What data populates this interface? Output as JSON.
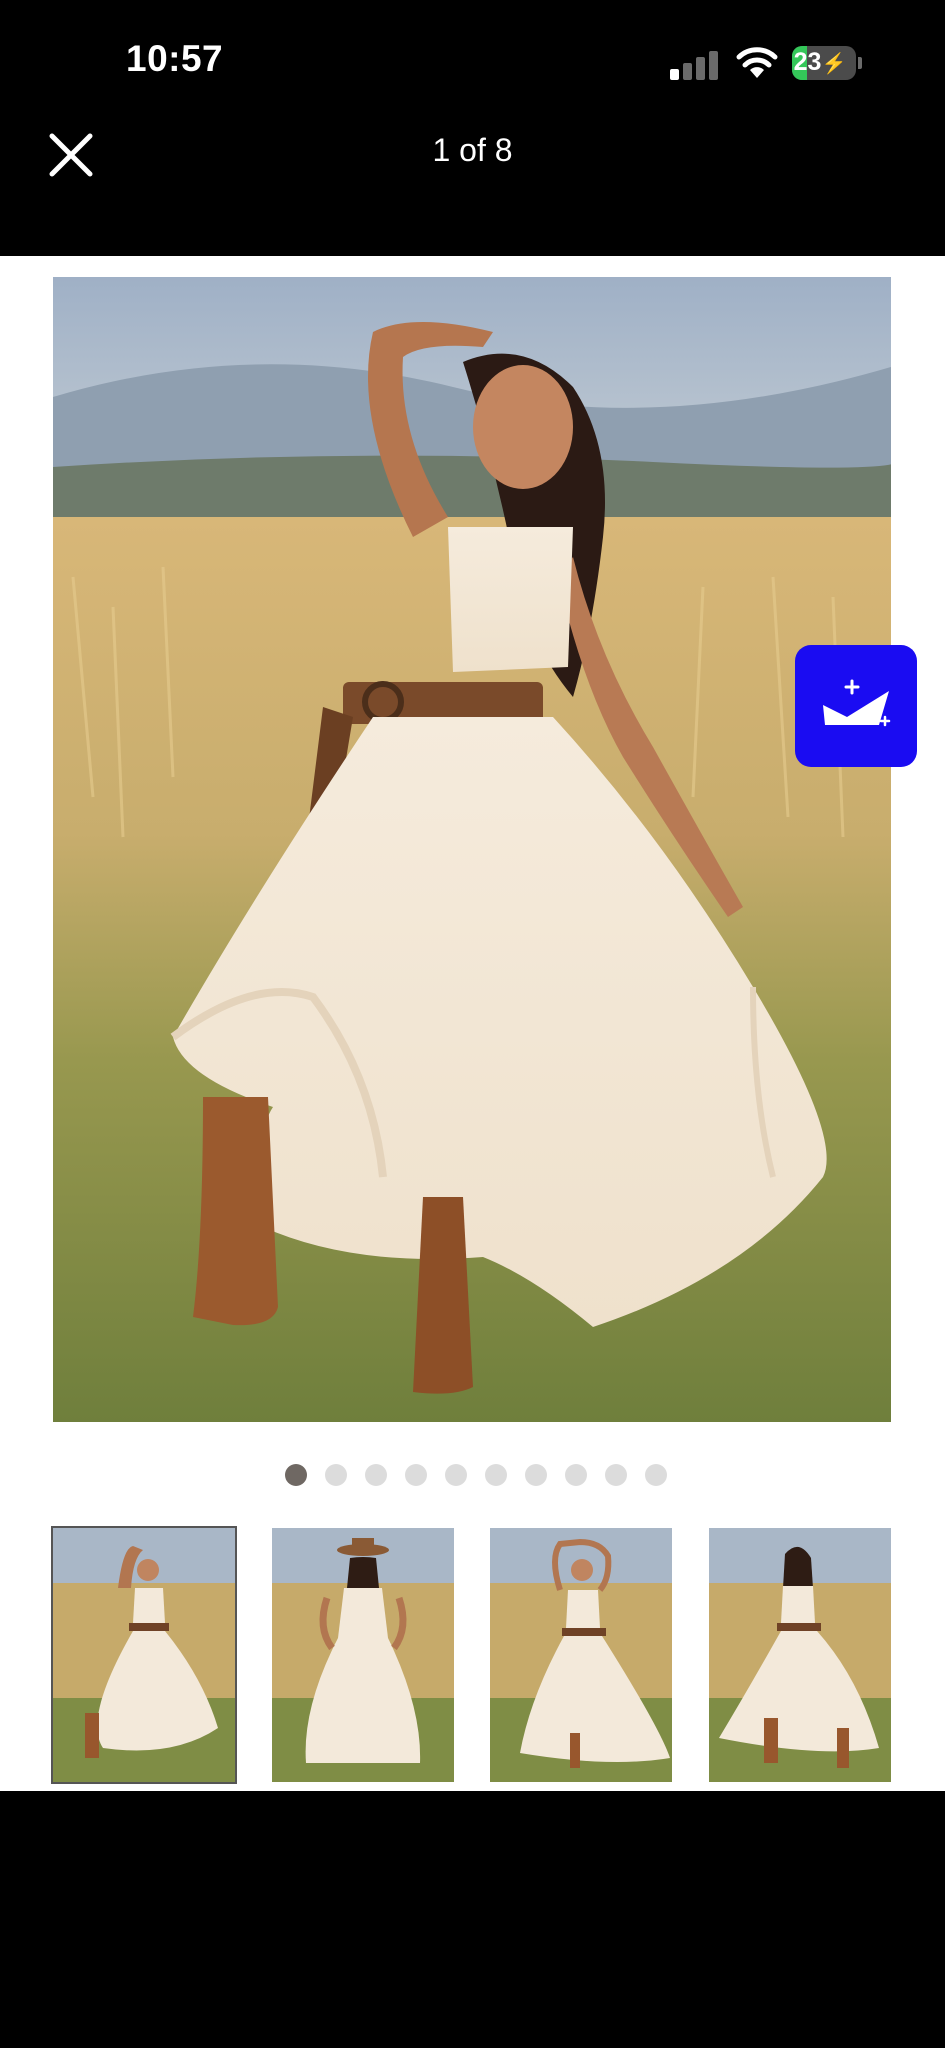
{
  "status_bar": {
    "time": "10:57",
    "battery": "23",
    "battery_level": 0.23,
    "signal_bars": 1
  },
  "header": {
    "counter": "1 of 8"
  },
  "gallery": {
    "current_index": 1,
    "total": 8,
    "dots_count": 10,
    "active_dot": 0,
    "thumbnails": [
      {
        "name": "thumbnail-1",
        "selected": true
      },
      {
        "name": "thumbnail-2",
        "selected": false
      },
      {
        "name": "thumbnail-3",
        "selected": false
      },
      {
        "name": "thumbnail-4",
        "selected": false
      }
    ]
  },
  "colors": {
    "ai_button": "#1a0cf2",
    "background": "#000000",
    "content": "#ffffff"
  },
  "icons": {
    "close": "close-icon",
    "ai": "ai-spark-icon",
    "wifi": "wifi-icon",
    "signal": "cellular-signal-icon"
  }
}
